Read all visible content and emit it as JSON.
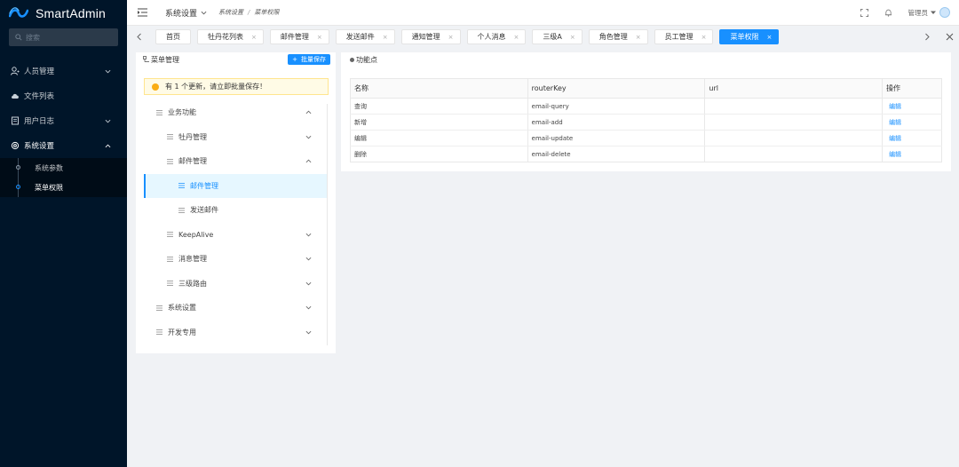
{
  "app": {
    "name": "SmartAdmin"
  },
  "sidebar": {
    "search_placeholder": "搜索",
    "items": [
      {
        "label": "人员管理",
        "icon": "user-icon",
        "expandable": true
      },
      {
        "label": "文件列表",
        "icon": "cloud-icon",
        "expandable": false
      },
      {
        "label": "用户日志",
        "icon": "document-icon",
        "expandable": true
      },
      {
        "label": "系统设置",
        "icon": "settings-icon",
        "expandable": true,
        "open": true
      }
    ],
    "sub_items": [
      {
        "label": "系统参数"
      },
      {
        "label": "菜单权限",
        "active": true
      }
    ]
  },
  "header": {
    "system_title": "系统设置",
    "breadcrumb": [
      "系统设置",
      "菜单权限"
    ],
    "username": "管理员"
  },
  "tabs": [
    {
      "label": "首页",
      "closable": false
    },
    {
      "label": "牡丹花列表",
      "closable": true
    },
    {
      "label": "邮件管理",
      "closable": true
    },
    {
      "label": "发送邮件",
      "closable": true
    },
    {
      "label": "通知管理",
      "closable": true
    },
    {
      "label": "个人消息",
      "closable": true
    },
    {
      "label": "三级A",
      "closable": true
    },
    {
      "label": "角色管理",
      "closable": true
    },
    {
      "label": "员工管理",
      "closable": true
    },
    {
      "label": "菜单权限",
      "closable": true,
      "active": true
    }
  ],
  "tab_close_glyph": "×",
  "menu_panel": {
    "title": "菜单管理",
    "batch_save_label": "批量保存",
    "alert_text": "有 1 个更新，请立即批量保存！",
    "tree": [
      {
        "label": "业务功能",
        "level": 1,
        "expanded": true
      },
      {
        "label": "牡丹管理",
        "level": 2,
        "expanded": false
      },
      {
        "label": "邮件管理",
        "level": 2,
        "expanded": true
      },
      {
        "label": "邮件管理",
        "level": 3,
        "selected": true
      },
      {
        "label": "发送邮件",
        "level": 3
      },
      {
        "label": "KeepAlive",
        "level": 2,
        "expanded": false
      },
      {
        "label": "消息管理",
        "level": 2,
        "expanded": false
      },
      {
        "label": "三级路由",
        "level": 2,
        "expanded": false
      },
      {
        "label": "系统设置",
        "level": 1,
        "expanded": false
      },
      {
        "label": "开发专用",
        "level": 1,
        "expanded": false
      }
    ]
  },
  "function_panel": {
    "title": "功能点",
    "columns": [
      "名称",
      "routerKey",
      "url",
      "操作"
    ],
    "rows": [
      {
        "name": "查询",
        "routerKey": "email-query",
        "url": "",
        "action": "编辑"
      },
      {
        "name": "新增",
        "routerKey": "email-add",
        "url": "",
        "action": "编辑"
      },
      {
        "name": "编辑",
        "routerKey": "email-update",
        "url": "",
        "action": "编辑"
      },
      {
        "name": "删除",
        "routerKey": "email-delete",
        "url": "",
        "action": "编辑"
      }
    ]
  },
  "colors": {
    "primary": "#1890ff",
    "sidebar_bg": "#001529",
    "alert_bg": "#fffbe6",
    "warn": "#faad14"
  }
}
